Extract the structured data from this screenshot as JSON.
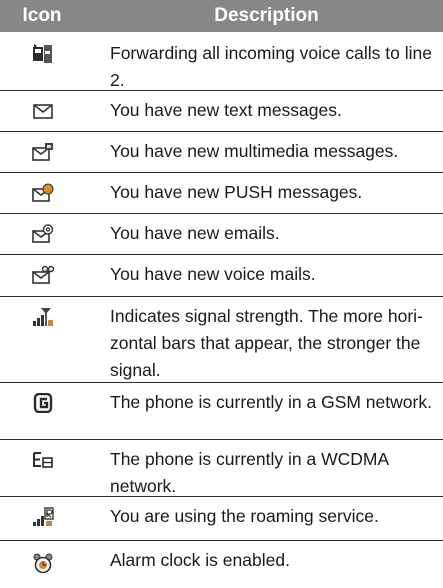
{
  "header": {
    "icon_col": "Icon",
    "desc_col": "Description"
  },
  "rows": [
    {
      "icon": "call-forward-line2-icon",
      "text": "Forwarding all incoming voice calls to line 2."
    },
    {
      "icon": "text-message-icon",
      "text": "You have new text messages."
    },
    {
      "icon": "multimedia-message-icon",
      "text": "You have new multimedia messages."
    },
    {
      "icon": "push-message-icon",
      "text": "You have new PUSH messages."
    },
    {
      "icon": "email-icon",
      "text": "You have new emails."
    },
    {
      "icon": "voice-mail-icon",
      "text": "You have new voice mails."
    },
    {
      "icon": "signal-strength-icon",
      "text": "Indicates signal strength. The more hori-zontal bars that appear, the stronger the signal."
    },
    {
      "icon": "gsm-network-icon",
      "text": "The phone is currently in a GSM network."
    },
    {
      "icon": "wcdma-network-icon",
      "text": "The phone is currently in a WCDMA network."
    },
    {
      "icon": "roaming-icon",
      "text": "You are using the roaming service."
    },
    {
      "icon": "alarm-clock-icon",
      "text": "Alarm clock is enabled."
    }
  ]
}
